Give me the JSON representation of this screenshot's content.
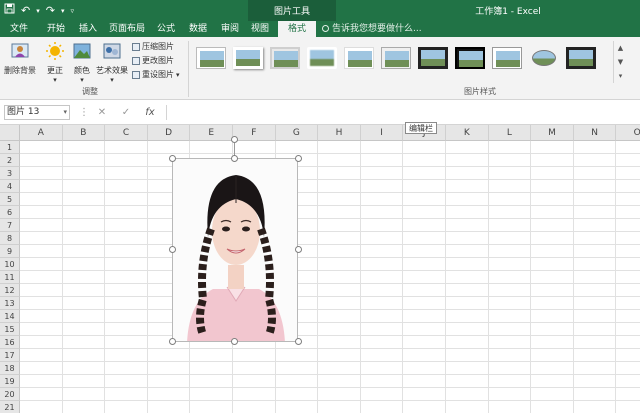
{
  "window": {
    "document_title": "工作簿1 - Excel",
    "context_group_title": "图片工具"
  },
  "tabs": [
    {
      "label": "文件"
    },
    {
      "label": "开始"
    },
    {
      "label": "插入"
    },
    {
      "label": "页面布局"
    },
    {
      "label": "公式"
    },
    {
      "label": "数据"
    },
    {
      "label": "审阅"
    },
    {
      "label": "视图"
    },
    {
      "label": "格式",
      "active": true,
      "contextual": true
    }
  ],
  "tell_me": "告诉我您想要做什么...",
  "ribbon": {
    "remove_bg": "删除背景",
    "corrections": "更正",
    "color": "颜色",
    "artistic": "艺术效果",
    "compress": "压缩图片",
    "change": "更改图片",
    "reset": "重设图片",
    "adjust_group": "调整",
    "styles_group": "图片样式",
    "style_count": 11
  },
  "formula_bar": {
    "name_box": "图片 13",
    "cancel_icon": "✕",
    "enter_icon": "✓",
    "fx_icon": "fx",
    "tooltip": "编辑栏"
  },
  "grid": {
    "columns": [
      "A",
      "B",
      "C",
      "D",
      "E",
      "F",
      "G",
      "H",
      "I",
      "J",
      "K",
      "L",
      "M",
      "N",
      "O"
    ],
    "rows": [
      "1",
      "2",
      "3",
      "4",
      "5",
      "6",
      "7",
      "8",
      "9",
      "10",
      "11",
      "12",
      "13",
      "14",
      "15",
      "16",
      "17",
      "18",
      "19",
      "20",
      "21",
      "22"
    ]
  },
  "picture": {
    "subject": "portrait photo of young woman with braided pigtails in pink shirt"
  },
  "colors": {
    "excel_green": "#217346",
    "ribbon_bg": "#f3f3f3",
    "header_bg": "#e6e6e6",
    "shirt_pink": "#f2c6cf"
  }
}
